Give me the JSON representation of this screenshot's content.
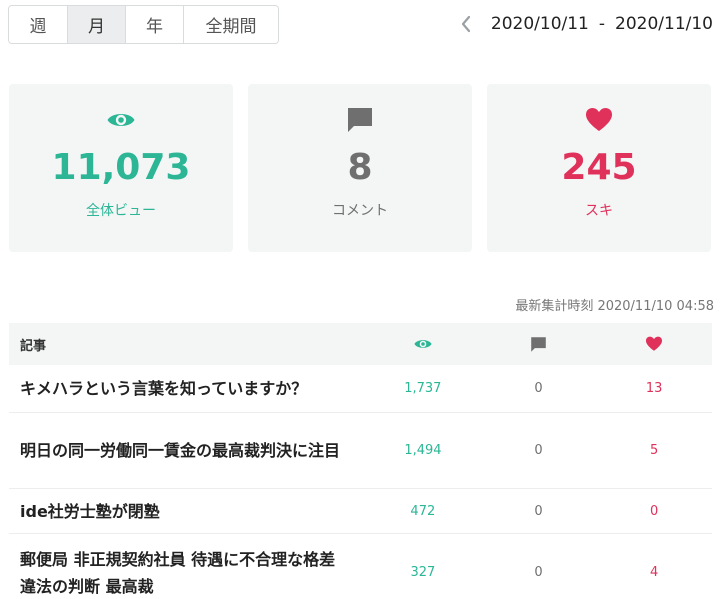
{
  "tabs": [
    {
      "label": "週",
      "active": false
    },
    {
      "label": "月",
      "active": true
    },
    {
      "label": "年",
      "active": false
    },
    {
      "label": "全期間",
      "active": false
    }
  ],
  "date_range": {
    "start": "2020/10/11",
    "separator": "-",
    "end": "2020/11/10"
  },
  "stats": {
    "views": {
      "value": "11,073",
      "label": "全体ビュー",
      "icon": "eye-icon",
      "color": "#2cb696"
    },
    "comments": {
      "value": "8",
      "label": "コメント",
      "icon": "comment-icon",
      "color": "#6f6f6f"
    },
    "likes": {
      "value": "245",
      "label": "スキ",
      "icon": "heart-icon",
      "color": "#e0315b"
    }
  },
  "last_updated": "最新集計時刻 2020/11/10 04:58",
  "table": {
    "header": {
      "title": "記事"
    },
    "rows": [
      {
        "title": "キメハラという言葉を知っていますか？",
        "views": "1,737",
        "comments": "0",
        "likes": "13"
      },
      {
        "title": "明日の同一労働同一賃金の最高裁判決に注目",
        "views": "1,494",
        "comments": "0",
        "likes": "5"
      },
      {
        "title": "ide社労士塾が閉塾",
        "views": "472",
        "comments": "0",
        "likes": "0"
      },
      {
        "title": "郵便局 非正規契約社員 待遇に不合理な格差 違法の判断 最高裁",
        "views": "327",
        "comments": "0",
        "likes": "4"
      }
    ]
  }
}
